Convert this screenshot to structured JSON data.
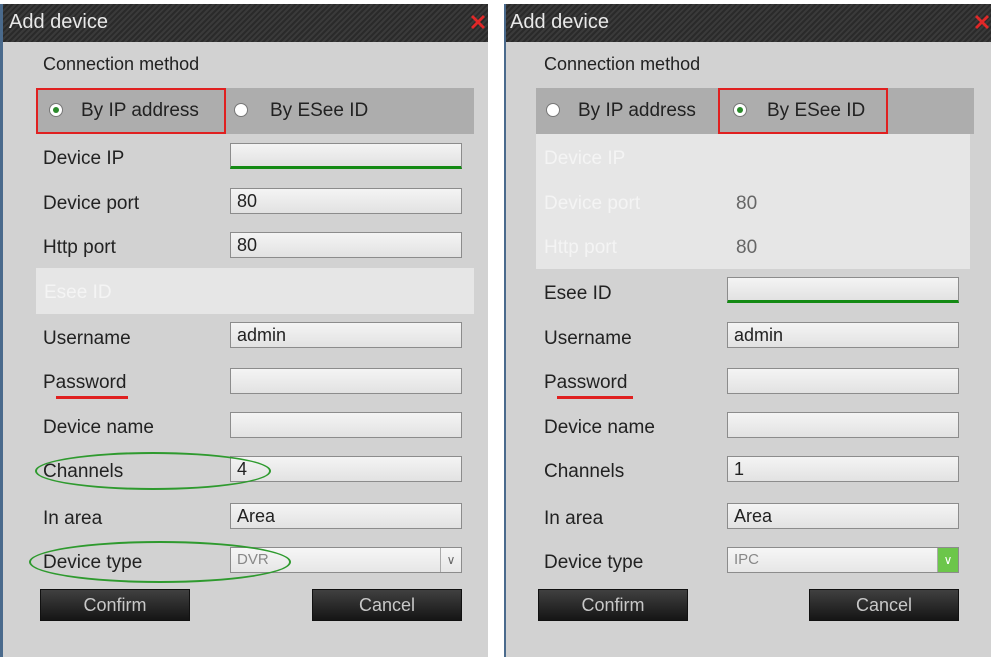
{
  "left": {
    "title": "Add device",
    "connection_method_label": "Connection method",
    "method_options": [
      "By IP address",
      "By ESee ID"
    ],
    "selected_method": "By IP address",
    "fields": {
      "device_ip": {
        "label": "Device IP",
        "value": ""
      },
      "device_port": {
        "label": "Device port",
        "value": "80"
      },
      "http_port": {
        "label": "Http port",
        "value": "80"
      },
      "esee_id": {
        "label": "Esee ID",
        "value": ""
      },
      "username": {
        "label": "Username",
        "value": "admin"
      },
      "password": {
        "label": "Password",
        "value": ""
      },
      "device_name": {
        "label": "Device name",
        "value": ""
      },
      "channels": {
        "label": "Channels",
        "value": "4"
      },
      "in_area": {
        "label": "In area",
        "value": "Area"
      },
      "device_type": {
        "label": "Device type",
        "value": "DVR"
      }
    },
    "confirm_label": "Confirm",
    "cancel_label": "Cancel"
  },
  "right": {
    "title": "Add device",
    "connection_method_label": "Connection method",
    "method_options": [
      "By IP address",
      "By ESee ID"
    ],
    "selected_method": "By ESee ID",
    "fields": {
      "device_ip": {
        "label": "Device IP",
        "value": ""
      },
      "device_port": {
        "label": "Device port",
        "value": "80"
      },
      "http_port": {
        "label": "Http port",
        "value": "80"
      },
      "esee_id": {
        "label": "Esee ID",
        "value": ""
      },
      "username": {
        "label": "Username",
        "value": "admin"
      },
      "password": {
        "label": "Password",
        "value": ""
      },
      "device_name": {
        "label": "Device name",
        "value": ""
      },
      "channels": {
        "label": "Channels",
        "value": "1"
      },
      "in_area": {
        "label": "In area",
        "value": "Area"
      },
      "device_type": {
        "label": "Device type",
        "value": "IPC"
      }
    },
    "confirm_label": "Confirm",
    "cancel_label": "Cancel"
  },
  "icons": {
    "close": "close-icon",
    "dropdown": "chevron-down-icon"
  },
  "colors": {
    "highlight_box": "#e02020",
    "annotation_ellipse": "#2e9a2e",
    "focus_underline": "#138a13",
    "titlebar": "#2f2f2f"
  }
}
